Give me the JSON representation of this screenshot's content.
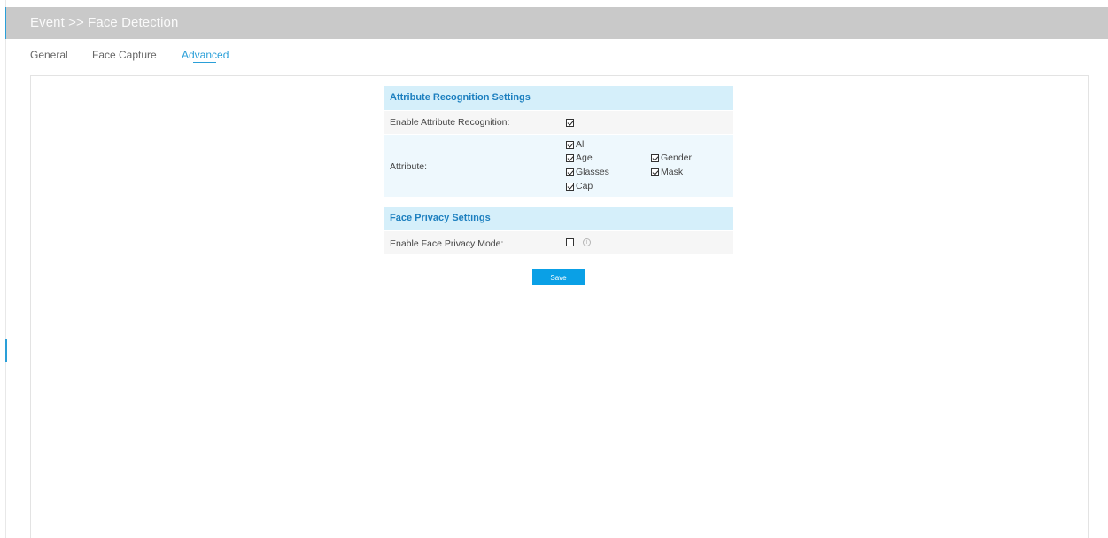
{
  "header": {
    "title": "Event >> Face Detection"
  },
  "tabs": [
    {
      "label": "General",
      "active": false
    },
    {
      "label": "Face Capture",
      "active": false
    },
    {
      "label": "Advanced",
      "active": true
    }
  ],
  "attribute_section": {
    "title": "Attribute Recognition Settings",
    "enable_label": "Enable Attribute Recognition:",
    "enable_checked": true,
    "attribute_label": "Attribute:",
    "options": [
      {
        "label": "All",
        "checked": true
      },
      {
        "label": "Age",
        "checked": true
      },
      {
        "label": "Gender",
        "checked": true
      },
      {
        "label": "Glasses",
        "checked": true
      },
      {
        "label": "Mask",
        "checked": true
      },
      {
        "label": "Cap",
        "checked": true
      }
    ]
  },
  "privacy_section": {
    "title": "Face Privacy Settings",
    "enable_label": "Enable Face Privacy Mode:",
    "enable_checked": false,
    "info_glyph": "i"
  },
  "save_label": "Save",
  "colors": {
    "accent": "#2a9fd8",
    "header_bg": "#c9c9c9",
    "section_bg": "#d5effa",
    "save_bg": "#0aa0e6"
  }
}
